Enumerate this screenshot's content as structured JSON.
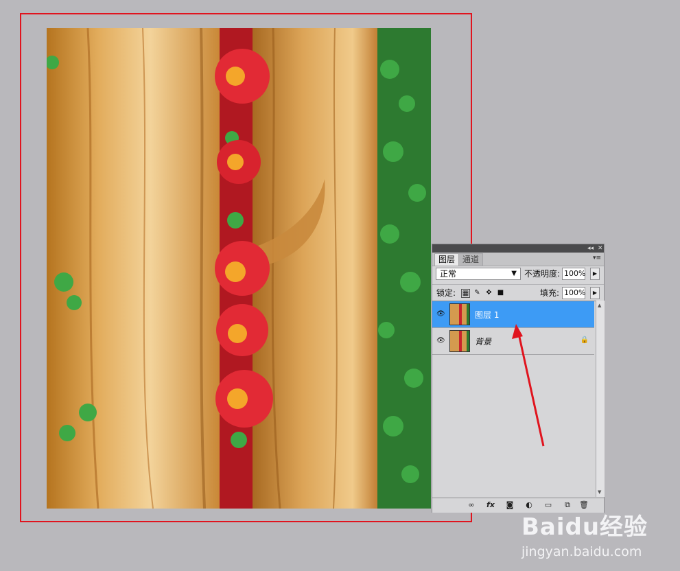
{
  "panel": {
    "tabs": [
      "图层",
      "通道"
    ],
    "blend_mode": "正常",
    "opacity_label": "不透明度:",
    "opacity_value": "100%",
    "lock_label": "锁定:",
    "fill_label": "填充:",
    "fill_value": "100%",
    "layers": [
      {
        "name": "图层 1",
        "selected": true,
        "locked": false
      },
      {
        "name": "背景",
        "selected": false,
        "locked": true
      }
    ],
    "bottom_icons": [
      "link-icon",
      "fx-icon",
      "mask-icon",
      "adjustment-icon",
      "folder-icon",
      "new-layer-icon",
      "trash-icon"
    ]
  },
  "colors": {
    "selection": "#3d9bf5",
    "annotation": "#e0141e",
    "background": "#b9b8bc"
  },
  "watermark": {
    "brand": "Baidu经验",
    "url": "jingyan.baidu.com"
  }
}
